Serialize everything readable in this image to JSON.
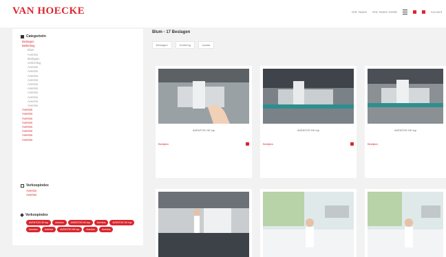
{
  "header": {
    "logo": "VAN HOECKE",
    "links": [
      "Ord. Name",
      "Ord. Name 12345",
      "Account"
    ]
  },
  "sidebar": {
    "categories_title": "Categorieën",
    "categories": [
      {
        "label": "Beslagen",
        "grey": false
      },
      {
        "label": "Bekleding",
        "grey": false
      },
      {
        "label": "Blum",
        "grey": true
      },
      {
        "label": "Aventos",
        "grey": true
      },
      {
        "label": "Beslagen",
        "grey": true
      },
      {
        "label": "Verlichting",
        "grey": true
      },
      {
        "label": "Aventos",
        "grey": true
      },
      {
        "label": "Aventos",
        "grey": true
      },
      {
        "label": "Aventos",
        "grey": true
      },
      {
        "label": "Aventos",
        "grey": true
      },
      {
        "label": "Aventos",
        "grey": true
      },
      {
        "label": "Aventos",
        "grey": true
      },
      {
        "label": "Aventos",
        "grey": true
      },
      {
        "label": "Aventos",
        "grey": true
      },
      {
        "label": "Aventos",
        "grey": true
      },
      {
        "label": "Aventos",
        "grey": true
      },
      {
        "label": "Aventos",
        "grey": false
      },
      {
        "label": "Aventos",
        "grey": false
      },
      {
        "label": "Aventos",
        "grey": false
      },
      {
        "label": "Aventos",
        "grey": false
      },
      {
        "label": "Aventos",
        "grey": false
      },
      {
        "label": "Aventos",
        "grey": false
      },
      {
        "label": "Aventos",
        "grey": false
      },
      {
        "label": "Aventos",
        "grey": false
      }
    ],
    "section2_title": "Verkoopindex",
    "section2_items": [
      "Aventos",
      "Aventos"
    ],
    "section3_title": "Verkoopindex",
    "tags": [
      "AVENTOS HK top",
      "Aventos",
      "AVENTOS HK top",
      "Aventos",
      "AVENTOS HK top",
      "Aventos",
      "Aventos",
      "AVENTOS HK top",
      "Aventos",
      "Aventos"
    ]
  },
  "main": {
    "title": "Blum - 17 Beslagen",
    "filters": [
      "Beslagen",
      "Sortering",
      "Aantal"
    ],
    "products": [
      {
        "name": "AVENTOS HK top",
        "link": "Bekijken"
      },
      {
        "name": "AVENTOS HK top",
        "link": "Bekijken"
      },
      {
        "name": "AVENTOS HK top",
        "link": "Bekijken"
      },
      {
        "name": "",
        "link": ""
      },
      {
        "name": "",
        "link": ""
      },
      {
        "name": "",
        "link": ""
      }
    ]
  },
  "colors": {
    "accent": "#d9272e",
    "background": "#f2f2f2"
  }
}
